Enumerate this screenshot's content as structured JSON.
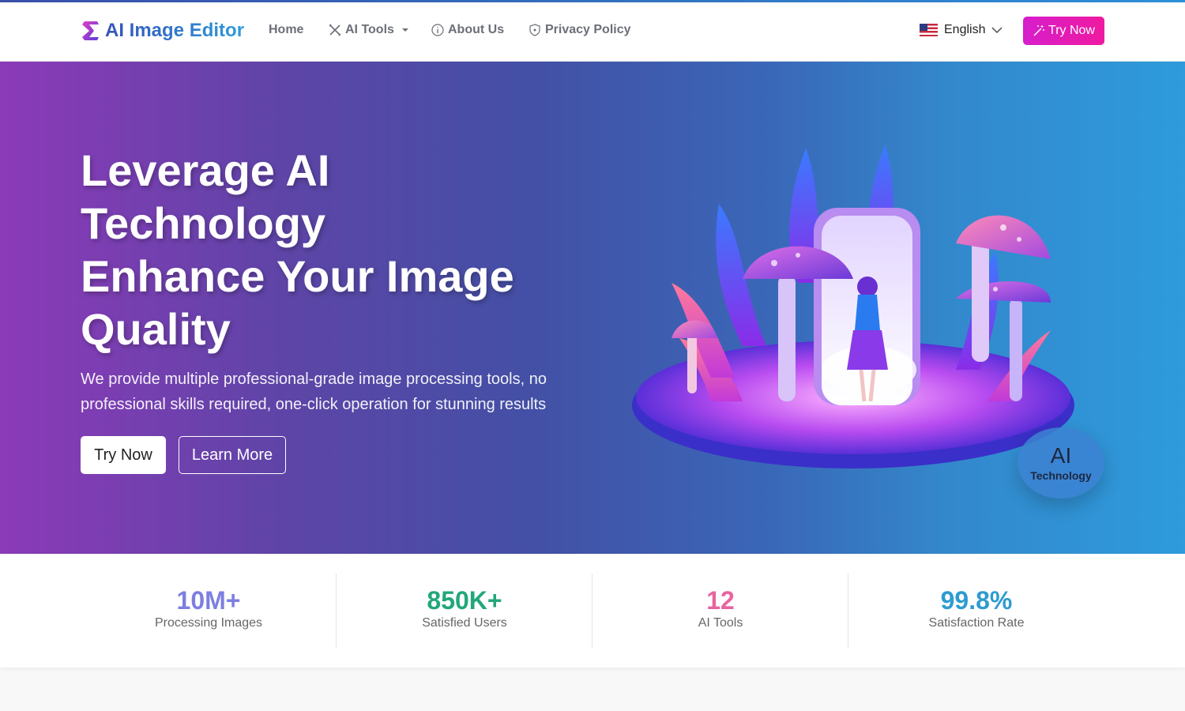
{
  "nav": {
    "logo_text": "AI Image Editor",
    "links": [
      {
        "label": "Home",
        "icon": ""
      },
      {
        "label": "AI Tools",
        "icon": "tools-icon"
      },
      {
        "label": "About Us",
        "icon": "info-icon"
      },
      {
        "label": "Privacy Policy",
        "icon": "shield-icon"
      }
    ],
    "language": "English",
    "try_label": "Try Now"
  },
  "hero": {
    "title_lines": [
      "Leverage AI",
      "Technology",
      "Enhance Your Image",
      "Quality"
    ],
    "subtitle": "We provide multiple professional-grade image processing tools, no professional skills required, one-click operation for stunning results",
    "primary_label": "Try Now",
    "secondary_label": "Learn More",
    "badge_big": "AI",
    "badge_small": "Technology"
  },
  "stats": [
    {
      "value": "10M+",
      "label": "Processing Images",
      "color": "#7d7fe0"
    },
    {
      "value": "850K+",
      "label": "Satisfied Users",
      "color": "#22a77a"
    },
    {
      "value": "12",
      "label": "AI Tools",
      "color": "#e8649e"
    },
    {
      "value": "99.8%",
      "label": "Satisfaction Rate",
      "color": "#2e9bd0"
    }
  ],
  "colors": {
    "brand_gradient_start": "#3453b8",
    "brand_gradient_end": "#2e9bdb",
    "cta_pink": "#e51cb5",
    "hero_start": "#8c3ab8",
    "hero_end": "#2e9bdc"
  }
}
